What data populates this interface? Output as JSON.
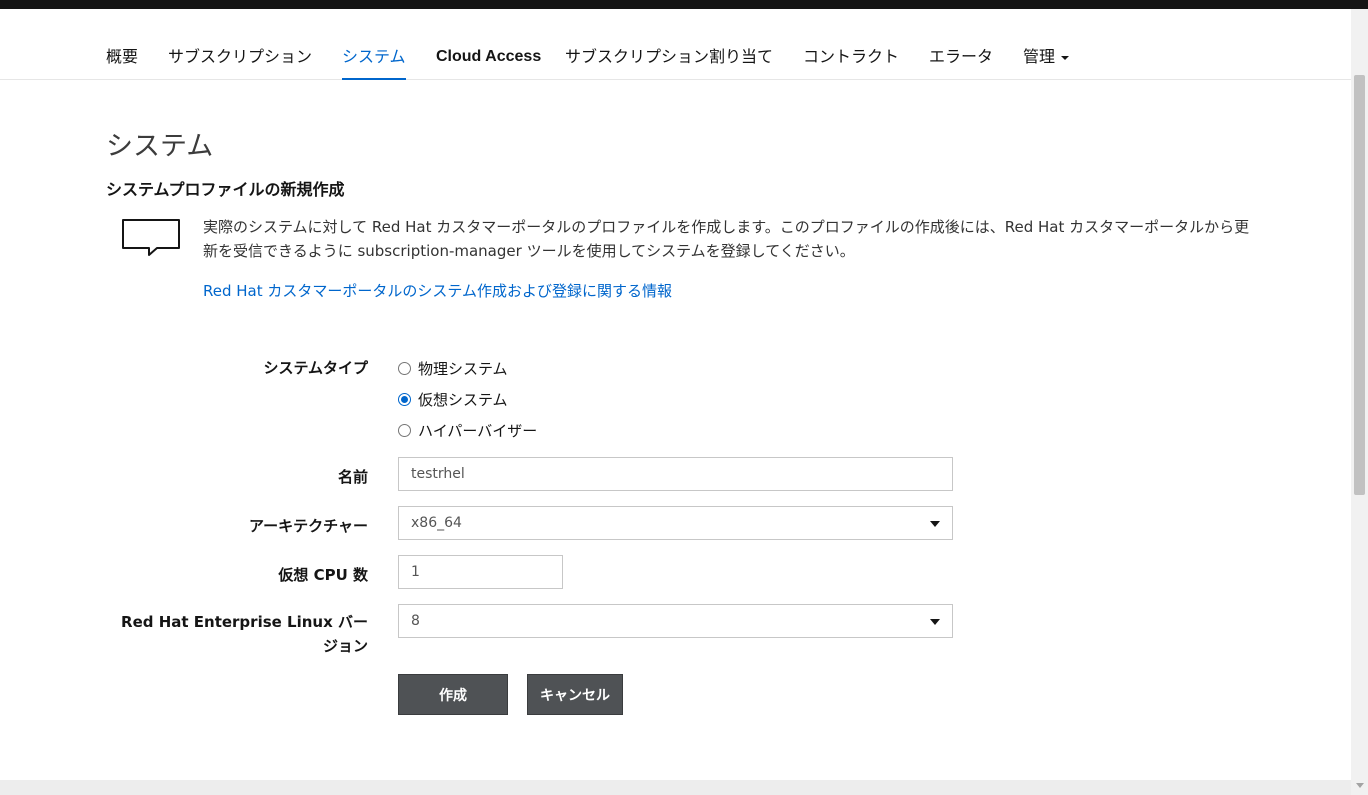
{
  "nav": {
    "tabs": [
      {
        "label": "概要"
      },
      {
        "label": "サブスクリプション"
      },
      {
        "label": "システム"
      },
      {
        "label": "Cloud Access"
      },
      {
        "label": "サブスクリプション割り当て"
      },
      {
        "label": "コントラクト"
      },
      {
        "label": "エラータ"
      },
      {
        "label": "管理"
      }
    ],
    "active": "システム"
  },
  "page": {
    "title": "システム",
    "section_title": "システムプロファイルの新規作成",
    "info_text": "実際のシステムに対して Red Hat カスタマーポータルのプロファイルを作成します。このプロファイルの作成後には、Red Hat カスタマーポータルから更新を受信できるように subscription-manager ツールを使用してシステムを登録してください。",
    "info_link": "Red Hat カスタマーポータルのシステム作成および登録に関する情報"
  },
  "form": {
    "system_type_label": "システムタイプ",
    "system_type_options": [
      {
        "label": "物理システム",
        "checked": false
      },
      {
        "label": "仮想システム",
        "checked": true
      },
      {
        "label": "ハイパーバイザー",
        "checked": false
      }
    ],
    "name_label": "名前",
    "name_value": "testrhel",
    "arch_label": "アーキテクチャー",
    "arch_value": "x86_64",
    "vcpu_label": "仮想 CPU 数",
    "vcpu_value": "1",
    "rhel_label": "Red Hat Enterprise Linux バージョン",
    "rhel_value": "8",
    "create_label": "作成",
    "cancel_label": "キャンセル"
  },
  "colors": {
    "accent": "#0066cc",
    "button": "#4f5255"
  }
}
